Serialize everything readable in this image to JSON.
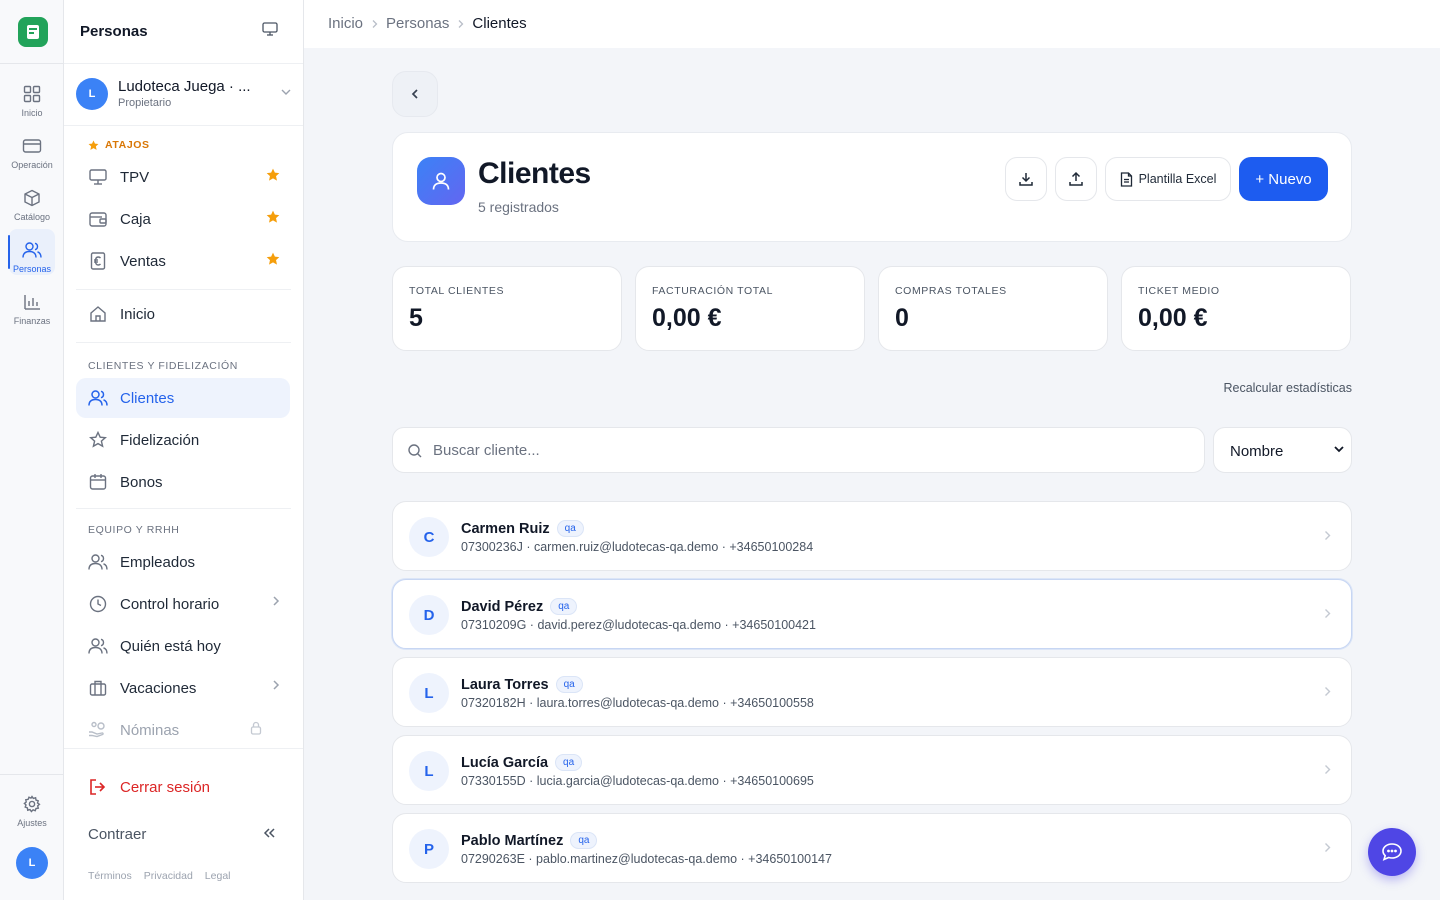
{
  "rail": {
    "items": [
      {
        "label": "Inicio",
        "icon": "grid-icon"
      },
      {
        "label": "Operación",
        "icon": "card-icon"
      },
      {
        "label": "Catálogo",
        "icon": "box-icon"
      },
      {
        "label": "Personas",
        "icon": "users-icon",
        "active": true
      },
      {
        "label": "Finanzas",
        "icon": "bar-chart-icon"
      }
    ],
    "settings_label": "Ajustes",
    "avatar_letter": "L"
  },
  "sidebar": {
    "title": "Personas",
    "org": {
      "avatar_letter": "L",
      "name": "Ludoteca Juega · ...",
      "role": "Propietario"
    },
    "shortcuts_label": "ATAJOS",
    "shortcuts": [
      {
        "label": "TPV",
        "icon": "monitor-icon"
      },
      {
        "label": "Caja",
        "icon": "wallet-icon"
      },
      {
        "label": "Ventas",
        "icon": "euro-receipt-icon"
      }
    ],
    "home_label": "Inicio",
    "section_clients": "CLIENTES Y FIDELIZACIÓN",
    "clients_items": [
      {
        "label": "Clientes",
        "active": true
      },
      {
        "label": "Fidelización"
      },
      {
        "label": "Bonos"
      }
    ],
    "section_team": "EQUIPO Y RRHH",
    "team_items": [
      {
        "label": "Empleados"
      },
      {
        "label": "Control horario"
      },
      {
        "label": "Quién está hoy"
      },
      {
        "label": "Vacaciones"
      },
      {
        "label": "Nóminas"
      }
    ],
    "logout_label": "Cerrar sesión",
    "collapse_label": "Contraer",
    "footer": [
      "Términos",
      "Privacidad",
      "Legal"
    ]
  },
  "breadcrumb": [
    "Inicio",
    "Personas",
    "Clientes"
  ],
  "header": {
    "title": "Clientes",
    "subtitle": "5 registrados",
    "template_label": "Plantilla Excel",
    "new_label": "+ Nuevo"
  },
  "stats": [
    {
      "label": "TOTAL CLIENTES",
      "value": "5"
    },
    {
      "label": "FACTURACIÓN TOTAL",
      "value": "0,00 €"
    },
    {
      "label": "COMPRAS TOTALES",
      "value": "0"
    },
    {
      "label": "TICKET MEDIO",
      "value": "0,00 €"
    }
  ],
  "recalc_label": "Recalcular estadísticas",
  "search": {
    "placeholder": "Buscar cliente...",
    "value": ""
  },
  "sort": {
    "selected": "Nombre"
  },
  "clients": [
    {
      "initial": "C",
      "name": "Carmen Ruiz",
      "tag": "qa",
      "meta": "07300236J · carmen.ruiz@ludotecas-qa.demo · +34650100284"
    },
    {
      "initial": "D",
      "name": "David Pérez",
      "tag": "qa",
      "meta": "07310209G · david.perez@ludotecas-qa.demo · +34650100421"
    },
    {
      "initial": "L",
      "name": "Laura Torres",
      "tag": "qa",
      "meta": "07320182H · laura.torres@ludotecas-qa.demo · +34650100558"
    },
    {
      "initial": "L",
      "name": "Lucía García",
      "tag": "qa",
      "meta": "07330155D · lucia.garcia@ludotecas-qa.demo · +34650100695"
    },
    {
      "initial": "P",
      "name": "Pablo Martínez",
      "tag": "qa",
      "meta": "07290263E · pablo.martinez@ludotecas-qa.demo · +34650100147"
    }
  ],
  "colors": {
    "primary": "#1d5cf0",
    "accent": "#2563eb",
    "brand_green": "#22a35a",
    "danger": "#dc2626",
    "star": "#f59e0b",
    "chat": "#4f46e5"
  }
}
